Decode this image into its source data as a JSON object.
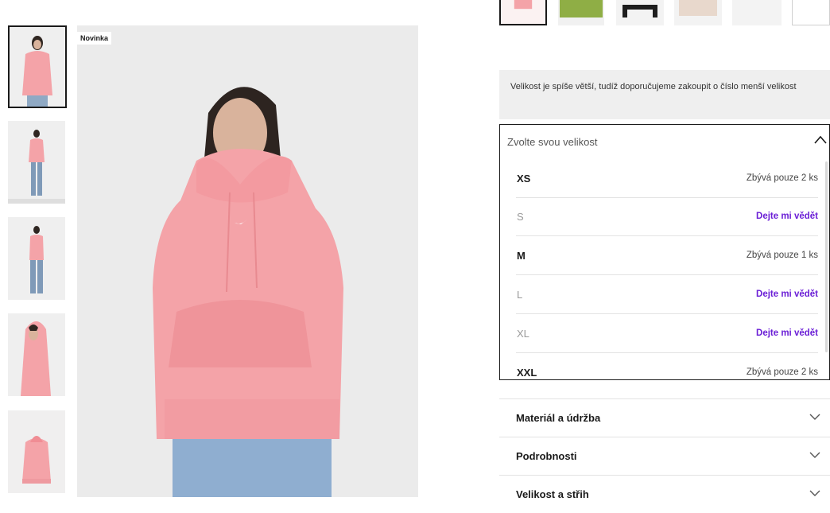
{
  "product": {
    "badge": "Novinka"
  },
  "info_note": "Velikost je spíše větší, tudíž doporučujeme zakoupit o číslo menší velikost",
  "size_selector": {
    "placeholder": "Zvolte svou velikost",
    "sizes": [
      {
        "size": "XS",
        "status": "Zbývá pouze 2 ks",
        "available": true
      },
      {
        "size": "S",
        "status": "Dejte mi vědět",
        "available": false
      },
      {
        "size": "M",
        "status": "Zbývá pouze 1 ks",
        "available": true
      },
      {
        "size": "L",
        "status": "Dejte mi vědět",
        "available": false
      },
      {
        "size": "XL",
        "status": "Dejte mi vědět",
        "available": false
      },
      {
        "size": "XXL",
        "status": "Zbývá pouze 2 ks",
        "available": true
      }
    ]
  },
  "accordions": [
    {
      "label": "Materiál a údržba"
    },
    {
      "label": "Podrobnosti"
    },
    {
      "label": "Velikost a střih"
    }
  ],
  "colors": {
    "accent_notify": "#6b1fd6",
    "hoodie_pink": "#f4a3a8",
    "swatch_green": "#8fae45",
    "swatch_black": "#1e1e1e",
    "swatch_beige": "#e8d8cc"
  }
}
